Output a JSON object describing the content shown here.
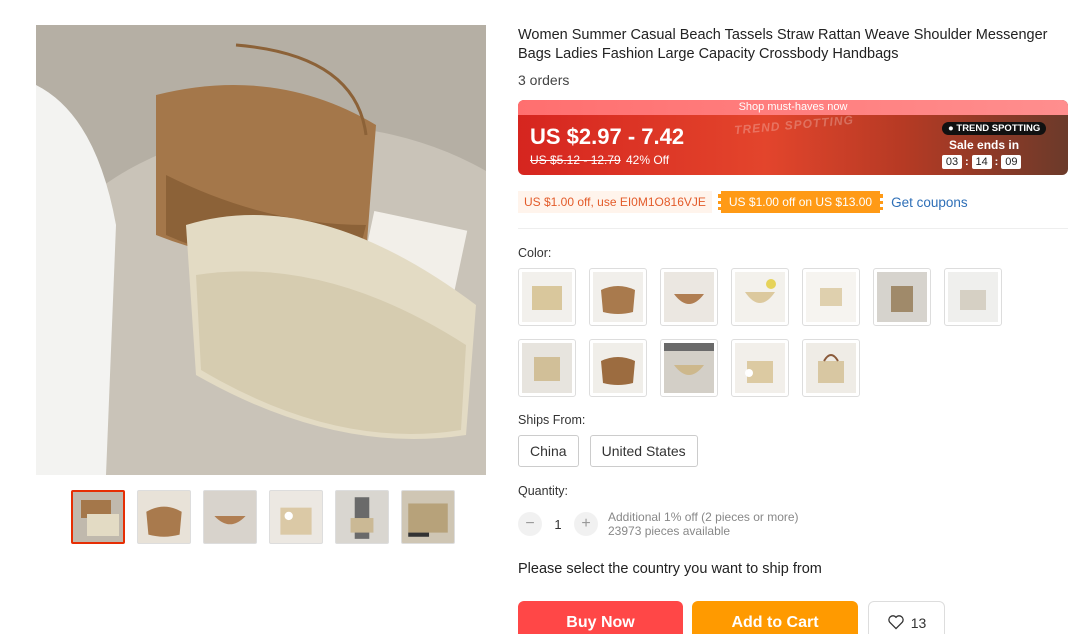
{
  "product": {
    "title": "Women Summer Casual Beach Tassels Straw Rattan Weave Shoulder Messenger Bags Ladies Fashion Large Capacity Crossbody Handbags",
    "orders": "3 orders"
  },
  "banner": {
    "strip_text": "Shop must-haves now",
    "price_range": "US $2.97 - 7.42",
    "original_price": "US $5.12 - 12.79",
    "discount": "42% Off",
    "deco_text": "TREND SPOTTING",
    "badge": "TREND SPOTTING",
    "sale_label": "Sale ends in",
    "timer": {
      "hours": "03",
      "minutes": "14",
      "seconds": "09",
      "sep": ":"
    }
  },
  "coupons": {
    "code_coupon": "US $1.00 off, use EI0M1O816VJE",
    "store_coupon": "US $1.00 off on US $13.00",
    "get_coupons": "Get coupons"
  },
  "options": {
    "color_label": "Color:",
    "ships_from_label": "Ships From:",
    "ships_from": [
      "China",
      "United States"
    ],
    "quantity_label": "Quantity:",
    "quantity_value": "1",
    "minus": "−",
    "plus": "+",
    "quantity_discount": "Additional 1% off (2 pieces or more)",
    "quantity_available": "23973 pieces available"
  },
  "ship_prompt": "Please select the country you want to ship from",
  "actions": {
    "buy_now": "Buy Now",
    "add_to_cart": "Add to Cart",
    "wishlist_count": "13"
  },
  "colors": {
    "accent": "#ff4747",
    "cart": "#ff9a00",
    "link": "#2e6fb7",
    "coupon_orange": "#ff9a16"
  },
  "icons": {
    "wishlist": "heart-icon"
  }
}
